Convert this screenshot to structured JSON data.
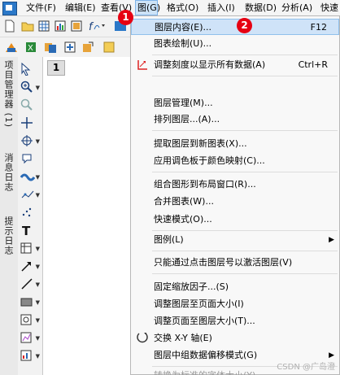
{
  "menubar": {
    "items": [
      "文件(F)",
      "编辑(E)",
      "查看(V)",
      "图(G)",
      "格式(O)",
      "插入(I)",
      "数据(D)",
      "分析(A)",
      "快速"
    ]
  },
  "sidepanel": {
    "tabs": [
      "项目管理器 (1)",
      "消息日志",
      "提示日志"
    ]
  },
  "workspace": {
    "page_tab": "1"
  },
  "dropdown": {
    "items": [
      {
        "label": "图层内容(E)...",
        "shortcut": "F12"
      },
      {
        "label": "图表绘制(U)..."
      },
      {
        "label": "调整刻度以显示所有数据(A)",
        "shortcut": "Ctrl+R"
      },
      {
        "label": "图层管理(M)..."
      },
      {
        "label": "排列图层...(A)..."
      },
      {
        "label": "提取图层到新图表(X)..."
      },
      {
        "label": "应用调色板于颜色映射(C)..."
      },
      {
        "label": "组合图形到布局窗口(R)..."
      },
      {
        "label": "合并图表(W)..."
      },
      {
        "label": "快速模式(O)..."
      },
      {
        "label": "图例(L)"
      },
      {
        "label": "只能通过点击图层号以激活图层(V)"
      },
      {
        "label": "固定缩放因子...(S)"
      },
      {
        "label": "调整图层至页面大小(I)"
      },
      {
        "label": "调整页面至图层大小(T)..."
      },
      {
        "label": "交换 X-Y 轴(E)"
      },
      {
        "label": "图层中组数据偏移模式(G)"
      },
      {
        "label": "转换为标准的字体大小(Y)"
      }
    ]
  },
  "badges": {
    "one": "1",
    "two": "2"
  },
  "watermark": "CSDN @广岛澄",
  "colors": {
    "highlight": "#cfe3f8",
    "badge": "#e60012",
    "accent": "#1a3f7a"
  }
}
